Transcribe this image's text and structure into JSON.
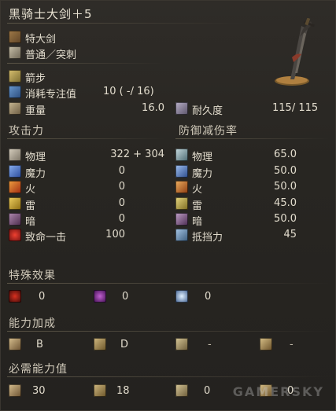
{
  "weapon": {
    "name": "黑骑士大剑＋5",
    "category": "特大剑",
    "attack_type": "普通／突刺",
    "skill": "箭步",
    "fp_cost_label": "消耗专注值",
    "fp_cost_value": "10 (   -/ 16)",
    "weight_label": "重量",
    "weight_value": "16.0",
    "durability_label": "耐久度",
    "durability_value": "115/   115"
  },
  "attack": {
    "heading": "攻击力",
    "rows": [
      {
        "label": "物理",
        "value": "322 +    304",
        "icon": "physical-icon"
      },
      {
        "label": "魔力",
        "value": "0",
        "icon": "magic-icon"
      },
      {
        "label": "火",
        "value": "0",
        "icon": "fire-icon"
      },
      {
        "label": "雷",
        "value": "0",
        "icon": "lightning-icon"
      },
      {
        "label": "暗",
        "value": "0",
        "icon": "dark-icon"
      },
      {
        "label": "致命一击",
        "value": "100",
        "icon": "critical-icon"
      }
    ]
  },
  "defense": {
    "heading": "防御减伤率",
    "rows": [
      {
        "label": "物理",
        "value": "65.0",
        "icon": "physical-guard-icon"
      },
      {
        "label": "魔力",
        "value": "50.0",
        "icon": "magic-guard-icon"
      },
      {
        "label": "火",
        "value": "50.0",
        "icon": "fire-guard-icon"
      },
      {
        "label": "雷",
        "value": "45.0",
        "icon": "lightning-guard-icon"
      },
      {
        "label": "暗",
        "value": "50.0",
        "icon": "dark-guard-icon"
      },
      {
        "label": "抵挡力",
        "value": "45",
        "icon": "stability-icon"
      }
    ]
  },
  "effects": {
    "heading": "特殊效果",
    "items": [
      {
        "value": "0",
        "icon": "bleed-icon"
      },
      {
        "value": "0",
        "icon": "poison-icon"
      },
      {
        "value": "0",
        "icon": "frost-icon"
      }
    ]
  },
  "scaling": {
    "heading": "能力加成",
    "items": [
      {
        "value": "B",
        "icon": "strength-icon"
      },
      {
        "value": "D",
        "icon": "dexterity-icon"
      },
      {
        "value": "-",
        "icon": "intelligence-icon"
      },
      {
        "value": "-",
        "icon": "faith-icon"
      }
    ]
  },
  "requirements": {
    "heading": "必需能力值",
    "items": [
      {
        "value": "30",
        "icon": "strength-req-icon"
      },
      {
        "value": "18",
        "icon": "dexterity-req-icon"
      },
      {
        "value": "0",
        "icon": "intelligence-req-icon"
      },
      {
        "value": "0",
        "icon": "faith-req-icon"
      }
    ]
  },
  "watermark": "GAMERSKY",
  "colors": {
    "physical": "#b8b2a4",
    "magic": "#5a7fc8",
    "fire": "#d8682a",
    "lightning": "#d8b040",
    "dark": "#8a6a8a",
    "critical": "#c83a2a"
  }
}
